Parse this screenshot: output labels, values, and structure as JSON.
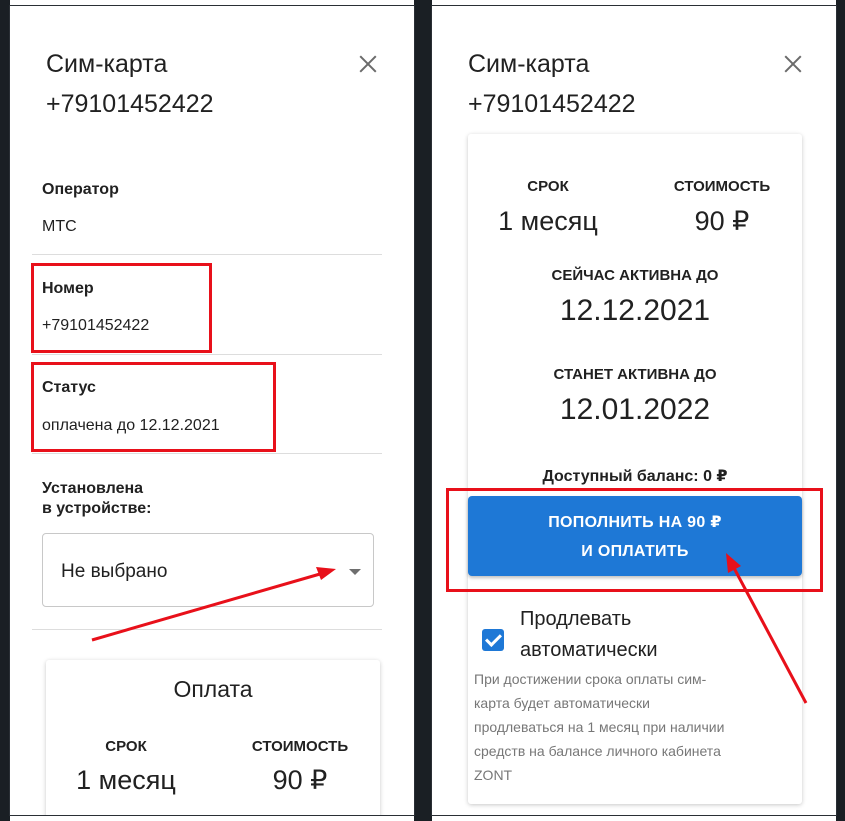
{
  "left_panel": {
    "title": "Сим-карта",
    "phone": "+79101452422",
    "operator": {
      "label": "Оператор",
      "value": "МТС"
    },
    "number": {
      "label": "Номер",
      "value": "+79101452422"
    },
    "status": {
      "label": "Статус",
      "value": "оплачена до 12.12.2021"
    },
    "device": {
      "label_line1": "Установлена",
      "label_line2": "в устройстве:",
      "selected": "Не выбрано"
    },
    "payment": {
      "title": "Оплата",
      "term_label": "СРОК",
      "term_value": "1 месяц",
      "cost_label": "СТОИМОСТЬ",
      "cost_value": "90 ₽"
    }
  },
  "right_panel": {
    "title": "Сим-карта",
    "phone": "+79101452422",
    "term_label": "СРОК",
    "term_value": "1 месяц",
    "cost_label": "СТОИМОСТЬ",
    "cost_value": "90 ₽",
    "active_now_label": "СЕЙЧАС АКТИВНА ДО",
    "active_now_value": "12.12.2021",
    "active_next_label": "СТАНЕТ АКТИВНА ДО",
    "active_next_value": "12.01.2022",
    "balance": "Доступный баланс: 0 ₽",
    "pay_button_line1": "ПОПОЛНИТЬ НА 90 ₽",
    "pay_button_line2": "И ОПЛАТИТЬ",
    "auto_renew_line1": "Продлевать",
    "auto_renew_line2": "автоматически",
    "auto_renew_checked": true,
    "hint_lines": [
      "При достижении срока оплаты сим-",
      "карта будет автоматически",
      "продлеваться на 1 месяц при наличии",
      "средств на балансе личного кабинета",
      "ZONT"
    ]
  },
  "colors": {
    "accent": "#1e78d6",
    "highlight": "#e8101a"
  },
  "icons": [
    "close-icon",
    "dropdown-caret-icon",
    "checkbox-checked-icon"
  ]
}
